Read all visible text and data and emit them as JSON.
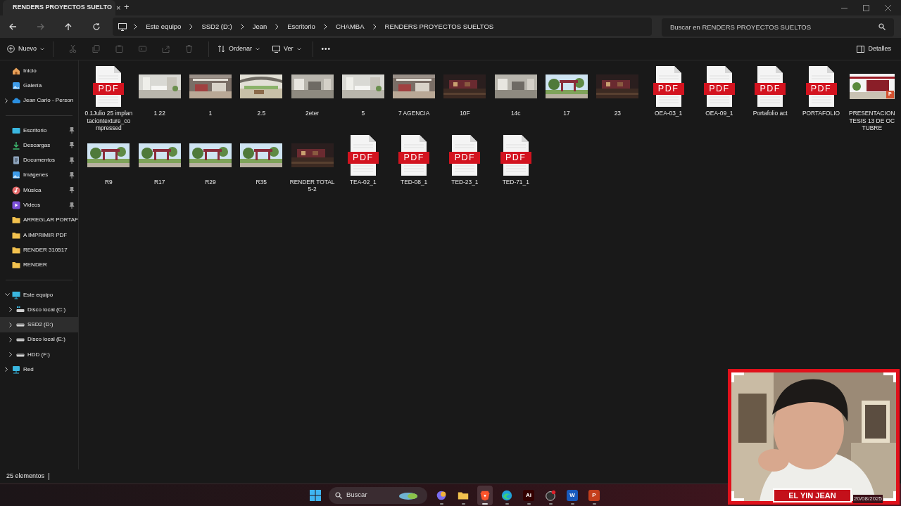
{
  "tab": {
    "title": "RENDERS PROYECTOS SUELTO",
    "close": "×",
    "new": "+"
  },
  "breadcrumb": [
    "Este equipo",
    "SSD2 (D:)",
    "Jean",
    "Escritorio",
    "CHAMBA",
    "RENDERS PROYECTOS SUELTOS"
  ],
  "search": {
    "placeholder": "Buscar en RENDERS PROYECTOS SUELTOS"
  },
  "toolbar": {
    "new": "Nuevo",
    "sort": "Ordenar",
    "view": "Ver",
    "more": "•••",
    "details": "Detalles"
  },
  "sidebar": {
    "items": [
      {
        "label": "Inicio",
        "kind": "home",
        "pinned": false
      },
      {
        "label": "Galería",
        "kind": "gallery",
        "pinned": false
      },
      {
        "label": "Jean Carlo - Person",
        "kind": "cloud",
        "pinned": false,
        "expanded": false
      },
      {
        "kind": "divider"
      },
      {
        "label": "Escritorio",
        "kind": "desktop",
        "pinned": true
      },
      {
        "label": "Descargas",
        "kind": "download",
        "pinned": true
      },
      {
        "label": "Documentos",
        "kind": "document",
        "pinned": true
      },
      {
        "label": "Imágenes",
        "kind": "gallery",
        "pinned": true
      },
      {
        "label": "Música",
        "kind": "music",
        "pinned": true
      },
      {
        "label": "Videos",
        "kind": "video",
        "pinned": true
      },
      {
        "label": "ARREGLAR PORTAF",
        "kind": "folder",
        "pinned": false
      },
      {
        "label": "A IMPRIMIR PDF",
        "kind": "folder",
        "pinned": false
      },
      {
        "label": "RENDER 310517",
        "kind": "folder",
        "pinned": false
      },
      {
        "label": "RENDER",
        "kind": "folder",
        "pinned": false
      },
      {
        "kind": "divider"
      },
      {
        "label": "Este equipo",
        "kind": "pc",
        "pinned": false,
        "expanded": true,
        "children": [
          {
            "label": "Disco local (C:)",
            "kind": "system-drive",
            "selected": false
          },
          {
            "label": "SSD2 (D:)",
            "kind": "drive",
            "selected": true
          },
          {
            "label": "Disco local (E:)",
            "kind": "drive",
            "selected": false
          },
          {
            "label": "HDD (F:)",
            "kind": "drive",
            "selected": false
          }
        ]
      },
      {
        "label": "Red",
        "kind": "network",
        "pinned": false,
        "expanded": false
      }
    ]
  },
  "files": [
    {
      "name": "0.1Julio 25 implantaciontexture_compressed",
      "kind": "pdf",
      "badge": "PDF"
    },
    {
      "name": "1.22",
      "kind": "picture"
    },
    {
      "name": "1",
      "kind": "picture"
    },
    {
      "name": "2.5",
      "kind": "picture"
    },
    {
      "name": "2eter",
      "kind": "picture"
    },
    {
      "name": "5",
      "kind": "picture"
    },
    {
      "name": "7 AGENCIA",
      "kind": "picture"
    },
    {
      "name": "10F",
      "kind": "picture"
    },
    {
      "name": "14c",
      "kind": "picture"
    },
    {
      "name": "17",
      "kind": "picture"
    },
    {
      "name": "23",
      "kind": "picture"
    },
    {
      "name": "OEA-03_1",
      "kind": "pdf",
      "badge": "PDF"
    },
    {
      "name": "OEA-09_1",
      "kind": "pdf",
      "badge": "PDF"
    },
    {
      "name": "Portafolio act",
      "kind": "pdf",
      "badge": "PDF"
    },
    {
      "name": "PORTAFOLIO",
      "kind": "pdf",
      "badge": "PDF"
    },
    {
      "name": "PRESENTACION TESIS 13 DE OCTUBRE",
      "kind": "presentation",
      "badge": "P"
    },
    {
      "name": "R9",
      "kind": "picture"
    },
    {
      "name": "R17",
      "kind": "picture"
    },
    {
      "name": "R29",
      "kind": "picture"
    },
    {
      "name": "R35",
      "kind": "picture"
    },
    {
      "name": "RENDER TOTAL 5-2",
      "kind": "picture"
    },
    {
      "name": "TEA-02_1",
      "kind": "pdf",
      "badge": "PDF"
    },
    {
      "name": "TED-08_1",
      "kind": "pdf",
      "badge": "PDF"
    },
    {
      "name": "TED-23_1",
      "kind": "pdf",
      "badge": "PDF"
    },
    {
      "name": "TED-71_1",
      "kind": "pdf",
      "badge": "PDF"
    }
  ],
  "status_bar": {
    "count": "25 elementos"
  },
  "taskbar": {
    "search": "Buscar",
    "apps": [
      {
        "kind": "copilot",
        "active": false
      },
      {
        "kind": "explorer",
        "active": false
      },
      {
        "kind": "brave",
        "active": true
      },
      {
        "kind": "edge",
        "active": false
      },
      {
        "kind": "letter",
        "glyph": "Ai",
        "color": "#330000",
        "active": false
      },
      {
        "kind": "obs",
        "active": false
      },
      {
        "kind": "letter",
        "glyph": "W",
        "color": "#185abd",
        "active": false
      },
      {
        "kind": "letter",
        "glyph": "P",
        "color": "#c43e1c",
        "active": false
      }
    ],
    "date": "20/08/2025"
  },
  "webcam": {
    "caption": "EL YIN JEAN"
  }
}
